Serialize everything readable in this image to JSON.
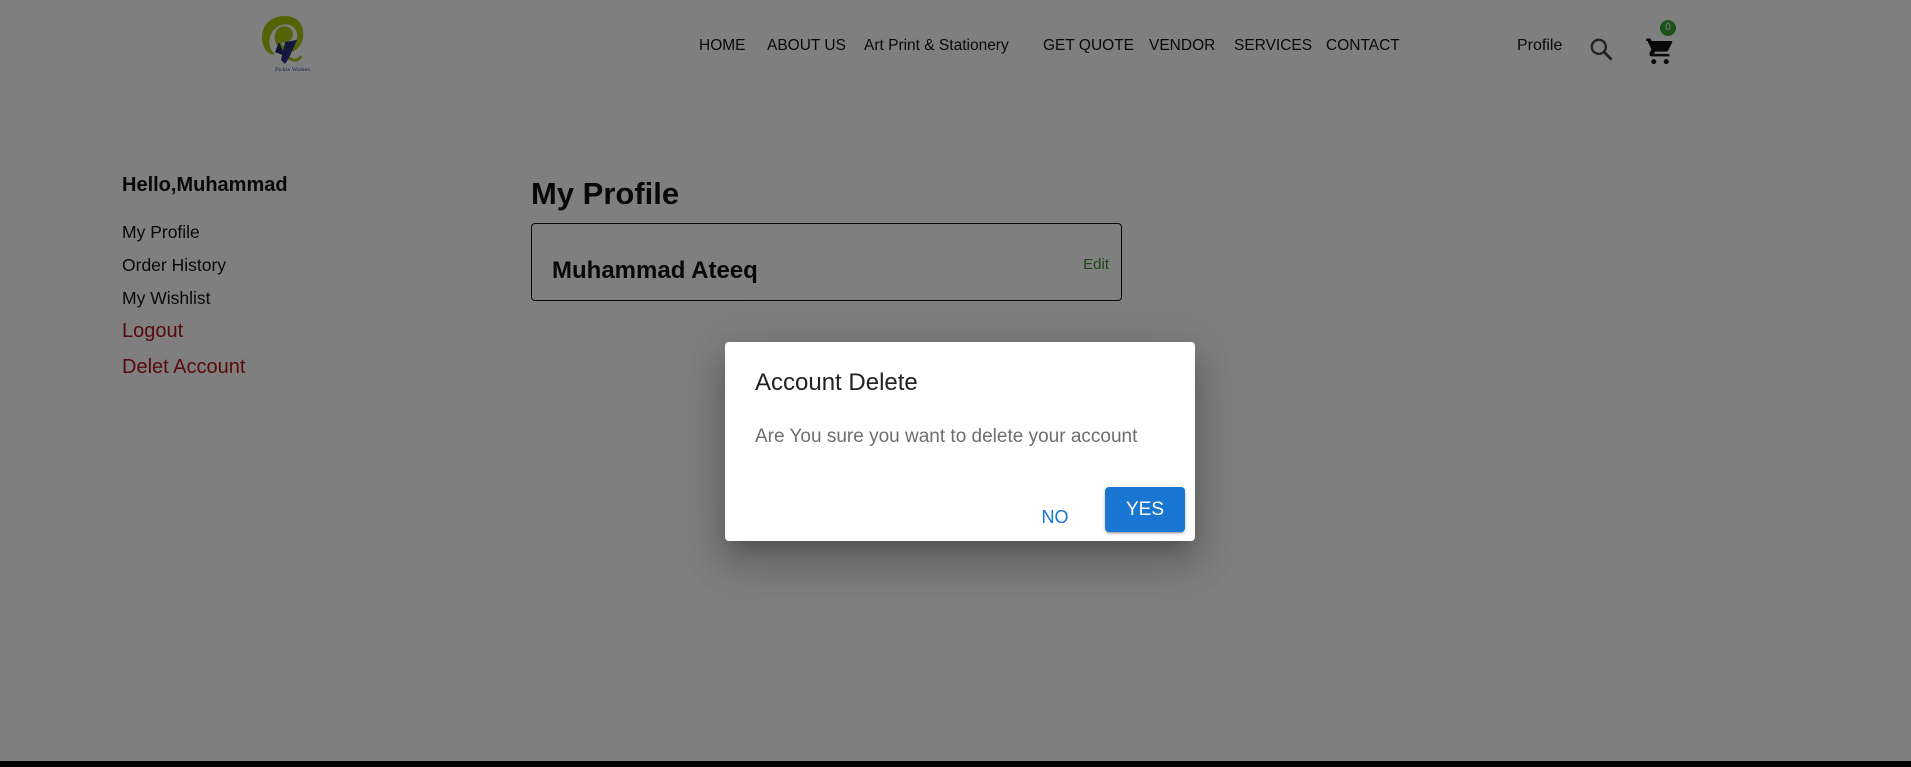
{
  "header": {
    "logo_text": "Pickle Wishes",
    "nav": [
      {
        "label": "HOME"
      },
      {
        "label": "ABOUT US"
      },
      {
        "label": "Art Print & Stationery"
      },
      {
        "label": "GET QUOTE"
      },
      {
        "label": "VENDOR"
      },
      {
        "label": "SERVICES"
      },
      {
        "label": "CONTACT"
      }
    ],
    "profile_label": "Profile",
    "cart_count": "0",
    "icons": {
      "search": "search-icon",
      "cart": "cart-icon"
    }
  },
  "sidebar": {
    "greeting": "Hello,Muhammad",
    "links": [
      {
        "label": "My Profile"
      },
      {
        "label": "Order History"
      },
      {
        "label": "My Wishlist"
      }
    ],
    "logout_label": "Logout",
    "delete_label": "Delet Account"
  },
  "main": {
    "title": "My Profile",
    "profile_name": "Muhammad Ateeq",
    "edit_label": "Edit"
  },
  "dialog": {
    "title": "Account Delete",
    "message": "Are You sure you want to delete your account",
    "no_label": "NO",
    "yes_label": "YES"
  },
  "colors": {
    "overlay": "#808080",
    "primary_button": "#1976d2",
    "danger_link": "#b3121b",
    "edit_link": "#3c8a2b",
    "cart_badge": "#3aa43a"
  }
}
